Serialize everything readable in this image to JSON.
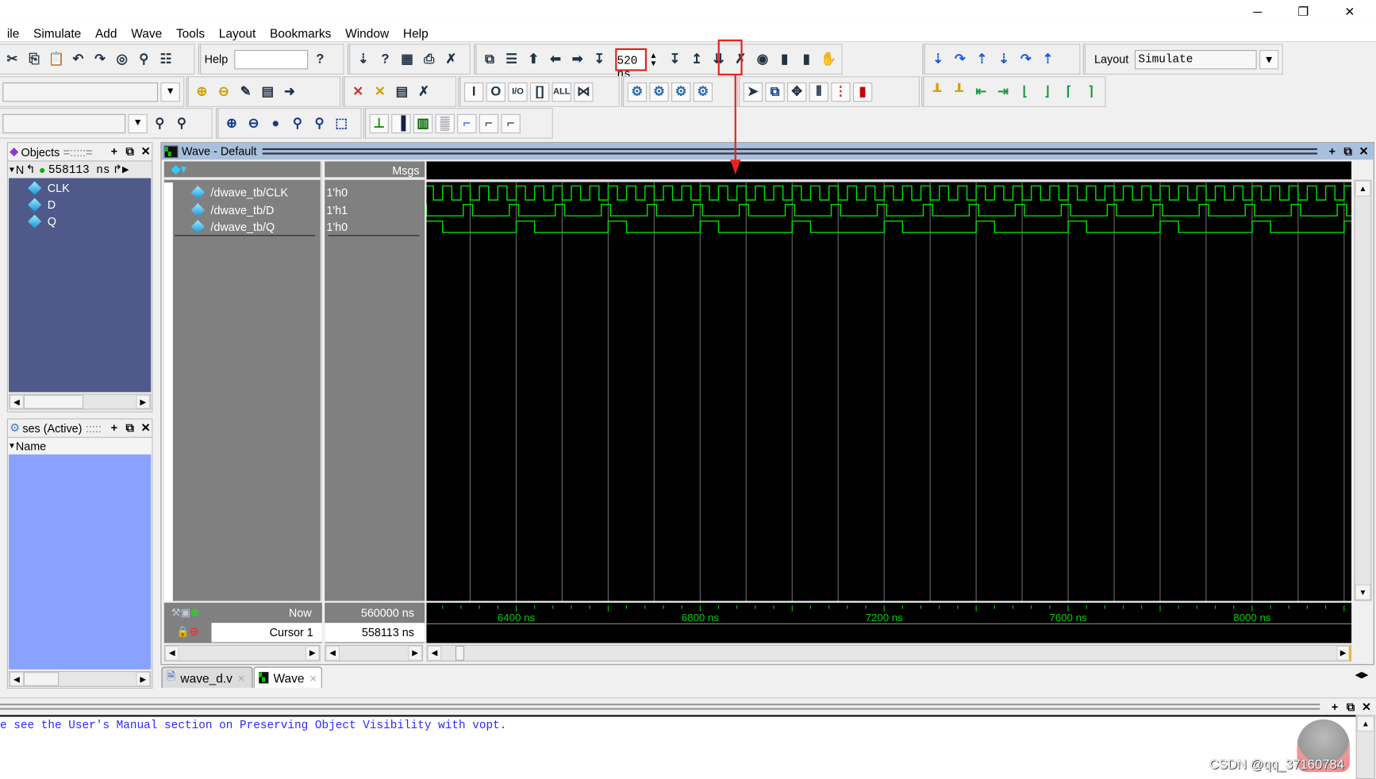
{
  "window": {
    "minimize_icon": "minimize-icon",
    "restore_icon": "restore-icon",
    "close_icon": "close-icon"
  },
  "menu": [
    "ile",
    "Simulate",
    "Add",
    "Wave",
    "Tools",
    "Layout",
    "Bookmarks",
    "Window",
    "Help"
  ],
  "toolbar": {
    "help_label": "Help",
    "help_value": "",
    "run_length": "520 ns",
    "layout_label": "Layout",
    "layout_value": "Simulate",
    "row1_icons": [
      "cut-icon",
      "copy-icon",
      "paste-icon",
      "undo-icon",
      "redo-icon",
      "compile-icon",
      "find-icon",
      "collapse-icon"
    ],
    "row1b_icons": [
      "help-search-icon"
    ],
    "row1c_icons": [
      "open-icon",
      "help-icon",
      "memory-icon",
      "print-icon",
      "delete-icon"
    ],
    "row1d_icons": [
      "link-icon",
      "list-icon",
      "up-arrow-icon",
      "back-arrow-icon",
      "forward-arrow-icon",
      "restart-icon"
    ],
    "row1e_icons": [
      "run-icon",
      "continue-icon",
      "run-all-icon",
      "break-icon",
      "stop-icon",
      "profile-icon",
      "memory-profile-icon",
      "hand-icon"
    ],
    "row1f_icons": [
      "step-into-icon",
      "step-over-icon",
      "step-out-icon",
      "step-into-all-icon",
      "step-over-all-icon",
      "step-out-all-icon"
    ],
    "row2_icons": [
      "add-wave-icon",
      "remove-wave-icon",
      "edit-wave-icon",
      "save-wave-icon",
      "export-wave-icon"
    ],
    "row2b_icons": [
      "insert-break-icon",
      "remove-break-icon",
      "doc-icon",
      "delete-break-icon"
    ],
    "row2c_icons": [
      "in-port-icon",
      "out-port-icon",
      "inout-icon",
      "internal-icon",
      "all-icon",
      "toggle-icon"
    ],
    "row2d_icons": [
      "gear-red-icon",
      "gear-yellow-icon",
      "gear-blue-icon",
      "gear-green-icon"
    ],
    "row2e_icons": [
      "select-pointer-icon",
      "zoom-box-icon",
      "pan-icon",
      "split-icon",
      "insert-divider-icon",
      "traffic-light-icon"
    ],
    "row2f_icons": [
      "add-cursor-icon",
      "remove-cursor-icon",
      "prev-edge-icon",
      "next-edge-icon",
      "prev-falling-icon",
      "next-falling-icon",
      "prev-rising-icon",
      "next-rising-icon"
    ],
    "row3_icons": [
      "search-icon",
      "search-next-icon"
    ],
    "row3b_icons": [
      "zoom-in-icon",
      "zoom-out-icon",
      "zoom-full-icon",
      "zoom-cursor-icon",
      "zoom-cursors-icon",
      "zoom-region-icon"
    ],
    "row3c_icons": [
      "literal-icon",
      "logic-icon",
      "analog-icon",
      "dotted-icon",
      "step-icon",
      "dashed-step-icon",
      "dashed-step2-icon"
    ]
  },
  "objects": {
    "title": "Objects",
    "time": "558113 ns",
    "col": "N",
    "items": [
      "CLK",
      "D",
      "Q"
    ]
  },
  "processes": {
    "title": "ses (Active)",
    "column": "Name"
  },
  "wave": {
    "title": "Wave - Default",
    "msgs": "Msgs",
    "signals": [
      {
        "name": "/dwave_tb/CLK",
        "value": "1'h0"
      },
      {
        "name": "/dwave_tb/D",
        "value": "1'h1"
      },
      {
        "name": "/dwave_tb/Q",
        "value": "1'h0"
      }
    ],
    "now_label": "Now",
    "now_value": "560000 ns",
    "cursor_label": "Cursor 1",
    "cursor_value": "558113 ns",
    "axis_labels": [
      "6400 ns",
      "6800 ns",
      "7200 ns",
      "7600 ns",
      "8000 ns"
    ],
    "colors": {
      "background": "#000000",
      "signal": "#00e000",
      "grid": "#6a6a6a",
      "axis_text": "#00d000"
    }
  },
  "chart_data": {
    "type": "line",
    "xlim": [
      6205,
      8216
    ],
    "x_unit": "ns",
    "axis_ticks": [
      6400,
      6800,
      7200,
      7600,
      8000
    ],
    "grid_step_ns": 100,
    "series": [
      {
        "name": "/dwave_tb/CLK",
        "period_ns": 40,
        "first_rise_ns": 6240,
        "high_ns": 20
      },
      {
        "name": "/dwave_tb/D",
        "period_ns": 100,
        "first_rise_ns": 6185,
        "high_ns": 20
      },
      {
        "name": "/dwave_tb/Q",
        "period_ns": 200,
        "first_rise_ns": 6200,
        "high_ns": 40
      }
    ]
  },
  "tabs": [
    {
      "label": "wave_d.v",
      "close": "×"
    },
    {
      "label": "Wave",
      "close": "×"
    }
  ],
  "transcript": {
    "line": "e see the User's Manual section on Preserving Object Visibility with vopt."
  },
  "watermark": "CSDN @qq_37160784"
}
